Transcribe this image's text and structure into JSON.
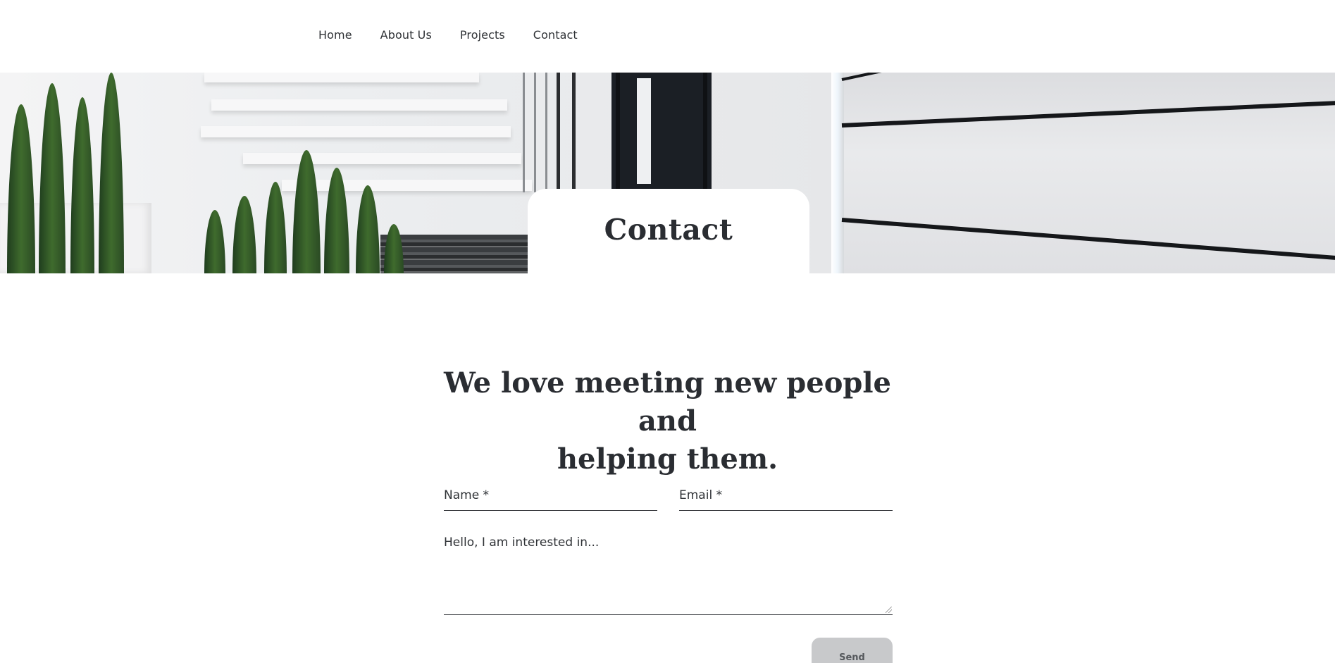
{
  "nav": {
    "items": [
      {
        "label": "Home"
      },
      {
        "label": "About Us"
      },
      {
        "label": "Projects"
      },
      {
        "label": "Contact"
      }
    ]
  },
  "hero": {
    "title": "Contact"
  },
  "main": {
    "headline_line1": "We love meeting new people and",
    "headline_line2": "helping them."
  },
  "form": {
    "name_label": "Name *",
    "email_label": "Email *",
    "message_placeholder": "Hello, I am interested in...",
    "send_label": "Send"
  },
  "colors": {
    "text": "#2a2d32",
    "button_bg": "#c8c9cb",
    "button_text": "#55585c",
    "background": "#ffffff"
  }
}
